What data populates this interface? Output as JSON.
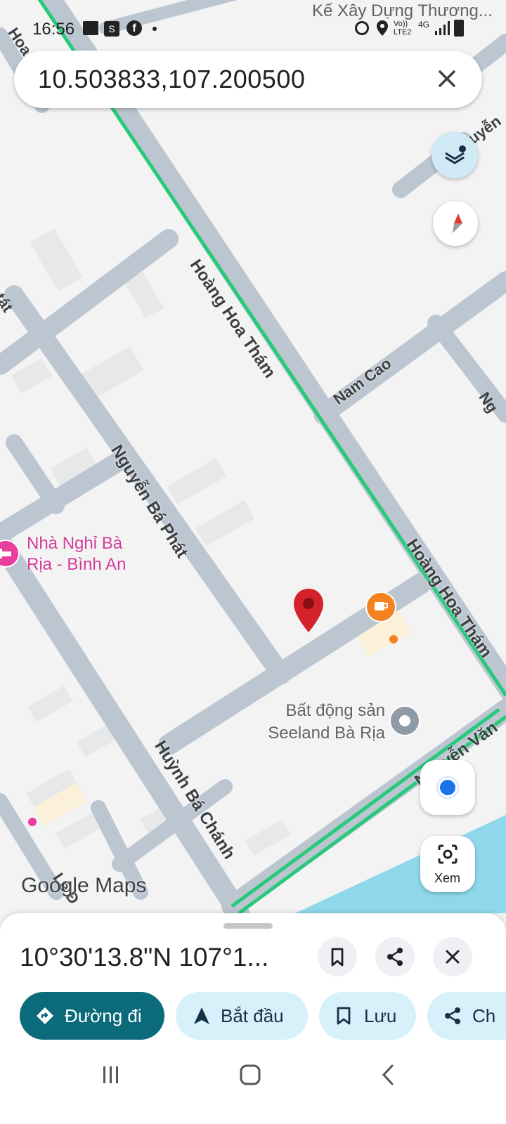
{
  "status_bar": {
    "time": "16:56",
    "top_right_text": "Kế Xây Dựng Thương...",
    "network_label": "Vo)) LTE2",
    "network_type": "4G"
  },
  "search": {
    "value": "10.503833,107.200500"
  },
  "map": {
    "streets": {
      "hoang_hoa_tham_1": "Hoàng Hoa Thám",
      "hoang_hoa_tham_2": "Hoàng Hoa Thám",
      "nam_cao": "Nam Cao",
      "nguyen_ba_phat": "Nguyễn Bá Phát",
      "huynh_ba_chanh": "Huỳnh Bá Chánh",
      "nguyen_van": "Nguyễn Văn",
      "edge_top_left": "Hoa Th",
      "edge_left": "tát",
      "edge_top_right": "uyễn",
      "edge_right": "Ng",
      "edge_bottom_left": "Lê Đ"
    },
    "places": {
      "hotel_line1": "Nhà Nghỉ Bà",
      "hotel_line2": "Rịa - Bình An",
      "realestate_line1": "Bất động sản",
      "realestate_line2": "Seeland Bà Rịa"
    },
    "google_logo": "Google Maps",
    "lens_label": "Xem",
    "colors": {
      "road": "#bcc6d1",
      "traffic": "#27c97a",
      "water": "#8fd8ec",
      "pin": "#d3222a",
      "poi_pink": "#e93e9e",
      "poi_orange": "#f58220"
    }
  },
  "sheet": {
    "coordinates": "10°30'13.8\"N 107°1...",
    "buttons": {
      "directions": "Đường đi",
      "start": "Bắt đầu",
      "save": "Lưu",
      "share": "Ch"
    }
  },
  "icons": [
    "image-icon",
    "shopping-bag-icon",
    "facebook-icon",
    "alarm-icon",
    "location-icon",
    "signal-icon",
    "battery-icon",
    "close-icon",
    "layers-icon",
    "compass-icon",
    "my-location-icon",
    "lens-icon",
    "bookmark-icon",
    "share-icon",
    "directions-icon",
    "navigation-arrow-icon",
    "recents-icon",
    "home-icon",
    "back-icon"
  ]
}
